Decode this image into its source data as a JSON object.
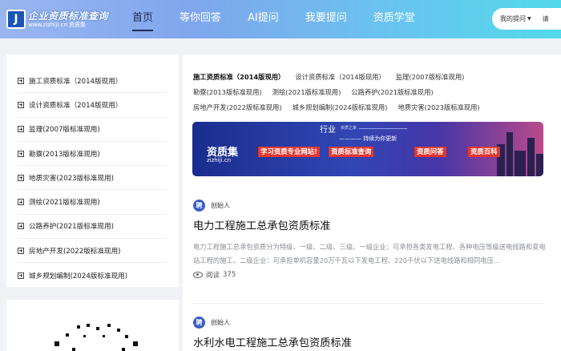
{
  "header": {
    "logo_title": "企业资质标准查询",
    "logo_sub": "www.zizhiji.cn 资质集",
    "logo_mark": "J",
    "nav": [
      "首页",
      "等你回答",
      "AI提问",
      "我要提问",
      "资质学堂"
    ],
    "my_questions": "我的提问",
    "ask_short": "请"
  },
  "sidebar": {
    "categories": [
      "施工资质标准（2014版现用）",
      "设计资质标准（2014版现用）",
      "监理(2007版标准现用)",
      "勘察(2013版标准现用)",
      "地质灾害(2023版标准现用)",
      "测绘(2021版标准现用)",
      "公路养护(2021版标准现用)",
      "房地产开发(2022版标准现用)",
      "城乡规划编制(2024版标准现用)"
    ]
  },
  "tags": {
    "row1": [
      "施工资质标准（2014版现用）",
      "设计资质标准（2014版现用）",
      "监理(2007版标准现用)"
    ],
    "row2": [
      "勘察(2013版标准现用)",
      "测绘(2021版标准现用)",
      "公路养护(2021版标准现用)"
    ],
    "row3": [
      "房地产开发(2022版标准现用)",
      "城乡规划编制(2024版标准现用)",
      "地质灾害(2023版标准现用)"
    ]
  },
  "banner": {
    "brand": "资质集",
    "url": "zizhiji.cn",
    "heading_main": "行业",
    "heading_sub": "资质之家",
    "slogan": "———— 持续为你更新",
    "red1": "学习资质专业网站!",
    "red2": "资质标准查询",
    "red3": "资质问答",
    "red4": "资质百科"
  },
  "articles": [
    {
      "avatar": "聘",
      "author": "创始人",
      "title": "电力工程施工总承包资质标准",
      "excerpt": "电力工程施工总承包资质分为特级、一级、二级、三级。一级企业：可承担各类发电工程、各种电压等级送电线路和变电站工程的施工。二级企业：可承担单机容量20万千瓦以下发电工程、220千伏以下送电线路和相同电压...",
      "reads_label": "阅读",
      "reads": "375"
    },
    {
      "avatar": "聘",
      "author": "创始人",
      "title": "水利水电工程施工总承包资质标准"
    }
  ]
}
